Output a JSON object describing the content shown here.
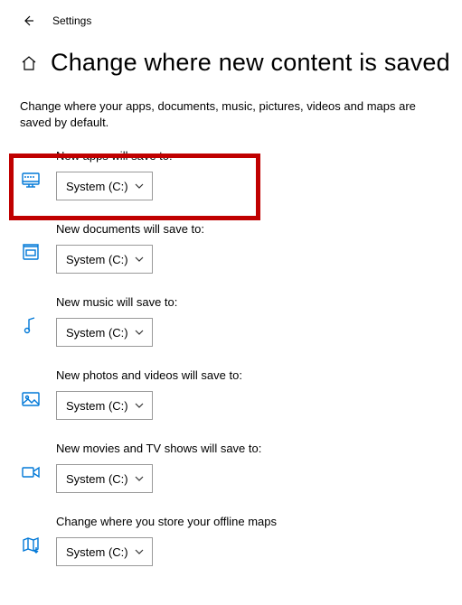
{
  "topbar": {
    "title": "Settings"
  },
  "page": {
    "heading": "Change where new content is saved",
    "description": "Change where your apps, documents, music, pictures, videos and maps are saved by default."
  },
  "settings": {
    "apps": {
      "label": "New apps will save to:",
      "value": "System (C:)"
    },
    "docs": {
      "label": "New documents will save to:",
      "value": "System (C:)"
    },
    "music": {
      "label": "New music will save to:",
      "value": "System (C:)"
    },
    "photos": {
      "label": "New photos and videos will save to:",
      "value": "System (C:)"
    },
    "movies": {
      "label": "New movies and TV shows will save to:",
      "value": "System (C:)"
    },
    "maps": {
      "label": "Change where you store your offline maps",
      "value": "System (C:)"
    }
  }
}
